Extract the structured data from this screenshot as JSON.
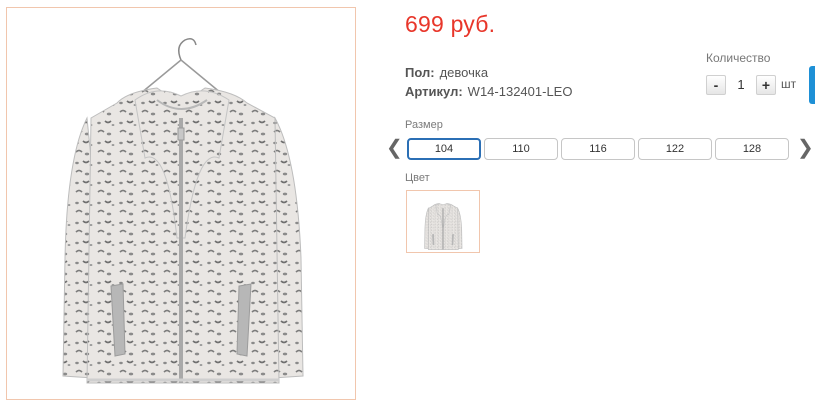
{
  "product": {
    "image_alt": "jacket-photo",
    "price": "699 руб.",
    "gender_label": "Пол:",
    "gender_value": "девочка",
    "sku_label": "Артикул:",
    "sku_value": "W14-132401-LEO"
  },
  "quantity": {
    "label": "Количество",
    "minus": "-",
    "value": "1",
    "plus": "+",
    "unit": "шт"
  },
  "sizes": {
    "label": "Размер",
    "prev": "❮",
    "next": "❯",
    "options": [
      "104",
      "110",
      "116",
      "122",
      "128"
    ],
    "selected": "104"
  },
  "colors": {
    "label": "Цвет"
  },
  "theme": {
    "price_color": "#e8362a",
    "accent_blue": "#2b6fb5",
    "frame_border": "#f1c6ad"
  }
}
